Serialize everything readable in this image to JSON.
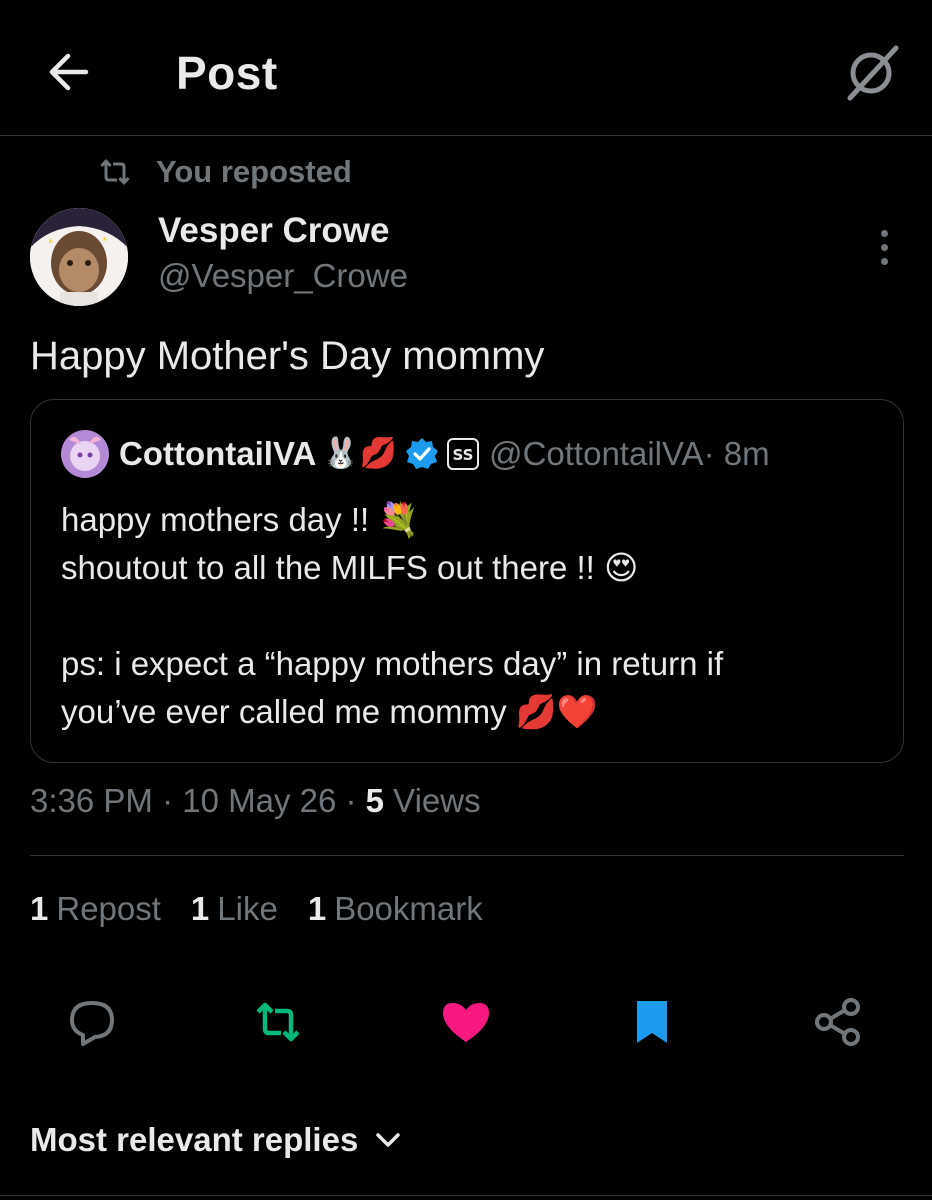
{
  "header": {
    "title": "Post"
  },
  "repost_banner": {
    "text": "You reposted"
  },
  "post": {
    "author_name": "Vesper Crowe",
    "author_handle": "@Vesper_Crowe",
    "text": "Happy Mother's Day mommy",
    "timestamp": "3:36 PM · 10 May 26 · ",
    "views_count": "5",
    "views_label": " Views"
  },
  "quote": {
    "author_name": "CottontailVA",
    "name_emoji": "🐰💋",
    "handle": "@CottontailVA",
    "time": " · 8m",
    "line1": "happy mothers day !! 💐",
    "line2": "shoutout to all the MILFS out there !! 😍",
    "line3": "ps: i expect a “happy mothers day” in return if",
    "line4": "you’ve ever called me mommy 💋❤️"
  },
  "stats": {
    "reposts_count": "1",
    "reposts_label": "Repost",
    "likes_count": "1",
    "likes_label": "Like",
    "bookmarks_count": "1",
    "bookmarks_label": "Bookmark"
  },
  "replies": {
    "sort_label": "Most relevant replies"
  },
  "colors": {
    "background": "#000000",
    "text_primary": "#e7e9ea",
    "text_secondary": "#71767b",
    "divider": "#2f3336",
    "repost_active": "#00ba7c",
    "like_active": "#f91880",
    "bookmark_active": "#1d9bf0",
    "verified": "#1d9bf0"
  },
  "icons": {
    "back": "arrow-left-icon",
    "grok": "grok-icon",
    "repost": "repost-icon",
    "more": "more-vertical-icon",
    "verified": "verified-badge-icon",
    "affiliate": "affiliate-badge-icon",
    "reply": "reply-icon",
    "like": "heart-icon",
    "bookmark": "bookmark-icon",
    "share": "share-icon",
    "chevron": "chevron-down-icon"
  }
}
